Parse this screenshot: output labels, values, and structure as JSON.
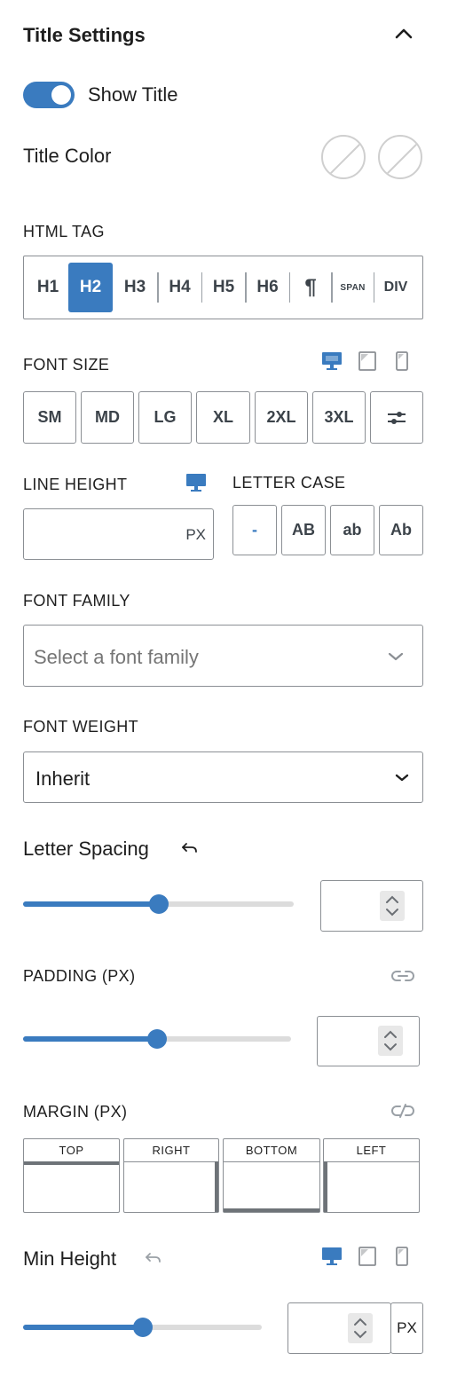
{
  "panel": {
    "title": "Title Settings"
  },
  "show_title": {
    "label": "Show Title",
    "enabled": true
  },
  "title_color": {
    "label": "Title Color"
  },
  "html_tag": {
    "label": "HTML TAG",
    "options": [
      "H1",
      "H2",
      "H3",
      "H4",
      "H5",
      "H6",
      "¶",
      "SPAN",
      "DIV"
    ],
    "selected": "H2"
  },
  "font_size": {
    "label": "FONT SIZE",
    "options": [
      "SM",
      "MD",
      "LG",
      "XL",
      "2XL",
      "3XL"
    ]
  },
  "line_height": {
    "label": "LINE HEIGHT",
    "unit": "PX",
    "value": ""
  },
  "letter_case": {
    "label": "LETTER CASE",
    "options": [
      "-",
      "AB",
      "ab",
      "Ab"
    ]
  },
  "font_family": {
    "label": "FONT FAMILY",
    "placeholder": "Select a font family"
  },
  "font_weight": {
    "label": "FONT WEIGHT",
    "value": "Inherit"
  },
  "letter_spacing": {
    "label": "Letter Spacing",
    "level": 0.5
  },
  "padding": {
    "label": "PADDING (PX)",
    "level": 0.5
  },
  "margin": {
    "label": "MARGIN (PX)",
    "sides": [
      "TOP",
      "RIGHT",
      "BOTTOM",
      "LEFT"
    ]
  },
  "min_height": {
    "label": "Min Height",
    "unit": "PX",
    "level": 0.5
  },
  "colors": {
    "accent": "#3a7bbf",
    "border": "#8b8f94",
    "muted": "#9aa0a6"
  }
}
